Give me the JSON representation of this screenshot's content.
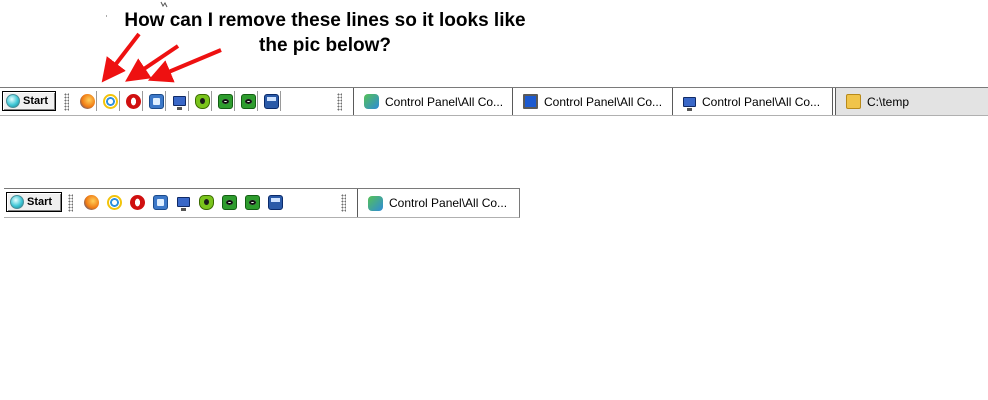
{
  "question": {
    "line1": "How can I remove these lines so it looks like",
    "line2": "the pic below?"
  },
  "accent_arrow_color": "#ee1111",
  "taskbar_top": {
    "start_label": "Start",
    "quicklaunch_icons": [
      "firefox-icon",
      "internet-explorer-icon",
      "opera-icon",
      "disk-tool-icon",
      "network-computer-icon",
      "shield-app-icon",
      "green-eye-icon",
      "green-eye-icon",
      "screen-capture-icon"
    ],
    "tasks": [
      {
        "label": "Control Panel\\All Co...",
        "icon": "control-panel-icon"
      },
      {
        "label": "Control Panel\\All Co...",
        "icon": "monitor-icon"
      },
      {
        "label": "Control Panel\\All Co...",
        "icon": "network-computer-icon"
      },
      {
        "label": "C:\\temp",
        "icon": "folder-icon"
      }
    ]
  },
  "taskbar_bottom": {
    "start_label": "Start",
    "quicklaunch_icons": [
      "firefox-icon",
      "internet-explorer-icon",
      "opera-icon",
      "disk-tool-icon",
      "network-computer-icon",
      "shield-app-icon",
      "green-eye-icon",
      "green-eye-icon",
      "screen-capture-icon"
    ],
    "tasks": [
      {
        "label": "Control Panel\\All Co...",
        "icon": "control-panel-icon"
      }
    ]
  }
}
